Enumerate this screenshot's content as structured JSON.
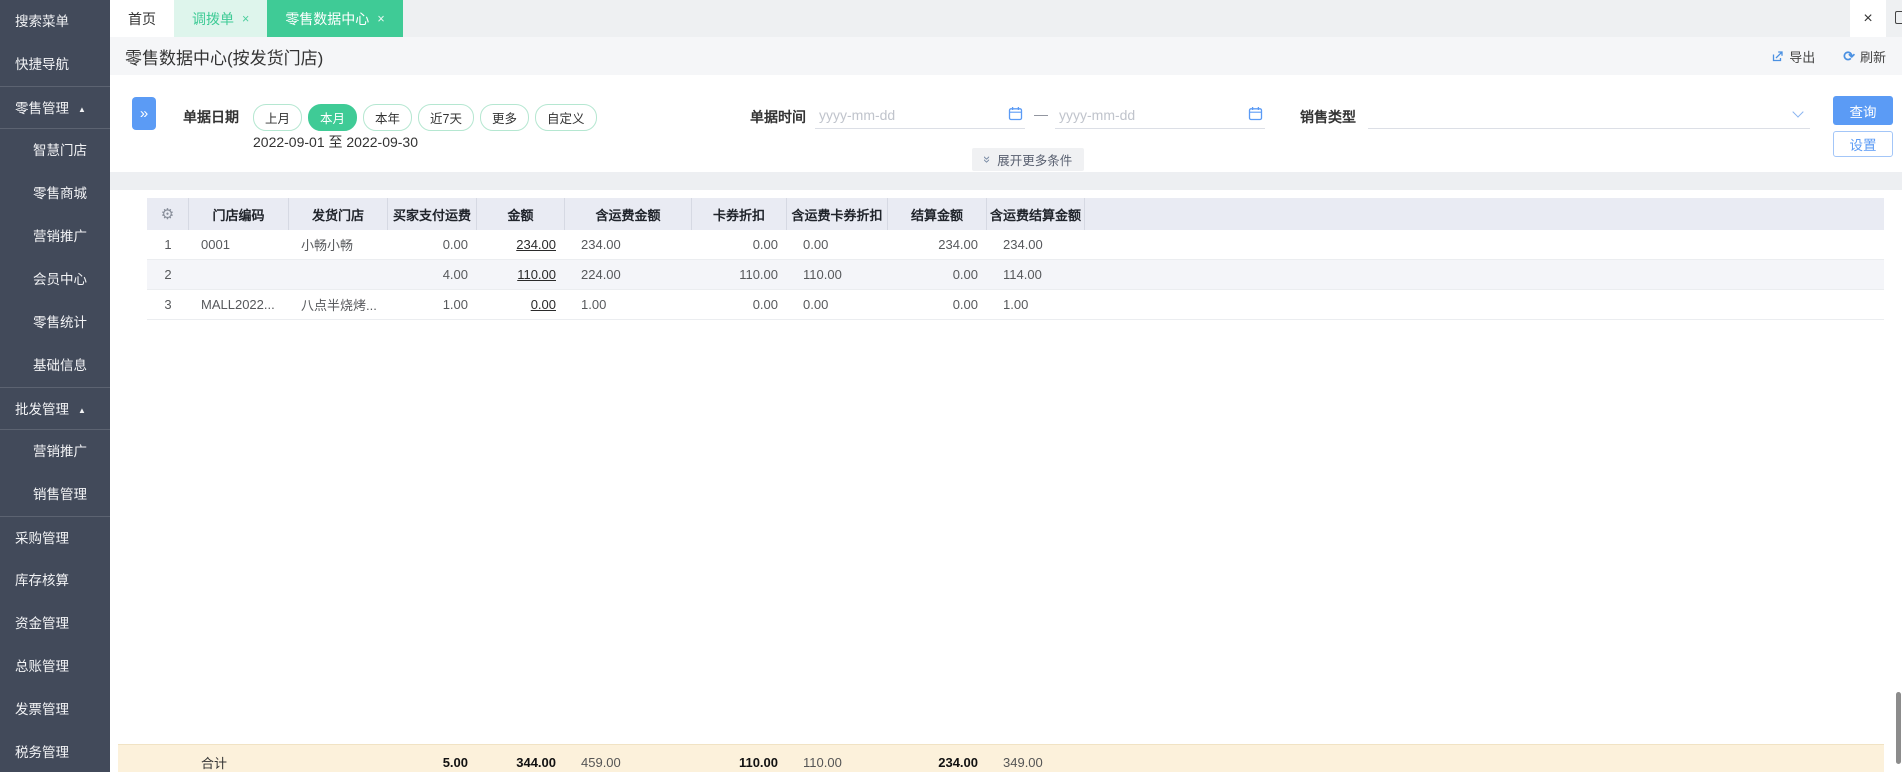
{
  "icons": {
    "sidebar_collapse_arrows": "»",
    "group_arrow_up": "▲",
    "tab_close": "×",
    "window_close": "×",
    "refresh": "⟳",
    "gear": "⚙",
    "expand_more_arrows": "»"
  },
  "sidebar": {
    "items": [
      {
        "id": "search-menu",
        "label": "搜索菜单",
        "type": "top"
      },
      {
        "id": "quick-nav",
        "label": "快捷导航",
        "type": "top"
      },
      {
        "id": "retail-mgmt",
        "label": "零售管理",
        "type": "group"
      },
      {
        "id": "smart-store",
        "label": "智慧门店",
        "type": "sub"
      },
      {
        "id": "retail-mall",
        "label": "零售商城",
        "type": "sub"
      },
      {
        "id": "marketing-promo",
        "label": "营销推广",
        "type": "sub"
      },
      {
        "id": "member-center",
        "label": "会员中心",
        "type": "sub"
      },
      {
        "id": "retail-stats",
        "label": "零售统计",
        "type": "sub"
      },
      {
        "id": "basic-info",
        "label": "基础信息",
        "type": "sub"
      },
      {
        "id": "wholesale-mgmt",
        "label": "批发管理",
        "type": "group"
      },
      {
        "id": "marketing-promo-wholesale",
        "label": "营销推广",
        "type": "sub"
      },
      {
        "id": "sales-mgmt",
        "label": "销售管理",
        "type": "sub"
      },
      {
        "id": "purchase-mgmt",
        "label": "采购管理",
        "type": "top",
        "divider": true
      },
      {
        "id": "inventory-accounting",
        "label": "库存核算",
        "type": "top"
      },
      {
        "id": "funds-mgmt",
        "label": "资金管理",
        "type": "top"
      },
      {
        "id": "general-ledger",
        "label": "总账管理",
        "type": "top"
      },
      {
        "id": "invoice-mgmt",
        "label": "发票管理",
        "type": "top"
      },
      {
        "id": "tax-mgmt",
        "label": "税务管理",
        "type": "top"
      }
    ]
  },
  "tabs": [
    {
      "id": "home",
      "label": "首页",
      "closable": false,
      "style": "plain"
    },
    {
      "id": "transfer-order",
      "label": "调拨单",
      "closable": true,
      "style": "mint"
    },
    {
      "id": "retail-data-center",
      "label": "零售数据中心",
      "closable": true,
      "style": "active"
    }
  ],
  "page": {
    "title": "零售数据中心(按发货门店)",
    "export_label": "导出",
    "refresh_label": "刷新"
  },
  "filters": {
    "date_label": "单据日期",
    "date_pills": [
      {
        "label": "上月",
        "active": false
      },
      {
        "label": "本月",
        "active": true
      },
      {
        "label": "本年",
        "active": false
      },
      {
        "label": "近7天",
        "active": false
      },
      {
        "label": "更多",
        "active": false
      },
      {
        "label": "自定义",
        "active": false
      }
    ],
    "date_range": "2022-09-01 至 2022-09-30",
    "time_label": "单据时间",
    "date_placeholder": "yyyy-mm-dd",
    "range_separator": "—",
    "sale_type_label": "销售类型",
    "sale_type_value": "",
    "search_label": "查询",
    "settings_label": "设置",
    "expand_more_label": "展开更多条件"
  },
  "table": {
    "columns": [
      {
        "id": "store-code",
        "label": "门店编码"
      },
      {
        "id": "shipping-store",
        "label": "发货门店"
      },
      {
        "id": "buyer-freight",
        "label": "买家支付运费"
      },
      {
        "id": "amount",
        "label": "金额"
      },
      {
        "id": "amount-with-freight",
        "label": "含运费金额"
      },
      {
        "id": "coupon-discount",
        "label": "卡券折扣"
      },
      {
        "id": "coupon-discount-with-freight",
        "label": "含运费卡券折扣"
      },
      {
        "id": "settle-amount",
        "label": "结算金额"
      },
      {
        "id": "settle-amount-with-freight",
        "label": "含运费结算金额"
      }
    ],
    "rows": [
      {
        "num": "1",
        "cells": [
          "0001",
          "小畅小畅",
          "0.00",
          "234.00",
          "234.00",
          "0.00",
          "0.00",
          "234.00",
          "234.00"
        ]
      },
      {
        "num": "2",
        "cells": [
          "",
          "",
          "4.00",
          "110.00",
          "224.00",
          "110.00",
          "110.00",
          "0.00",
          "114.00"
        ]
      },
      {
        "num": "3",
        "cells": [
          "MALL2022...",
          "八点半烧烤...",
          "1.00",
          "0.00",
          "1.00",
          "0.00",
          "0.00",
          "0.00",
          "1.00"
        ]
      }
    ],
    "footer": {
      "label": "合计",
      "cells": [
        "",
        "",
        "5.00",
        "344.00",
        "459.00",
        "110.00",
        "110.00",
        "234.00",
        "349.00"
      ]
    }
  },
  "colors": {
    "accent_green": "#3fcb96",
    "accent_blue": "#5b9bf5",
    "sidebar_bg": "#424a5a",
    "header_row_bg": "#e9ebf3",
    "stripe_bg": "#f4f5f9",
    "summary_bg": "#fcf1db"
  }
}
